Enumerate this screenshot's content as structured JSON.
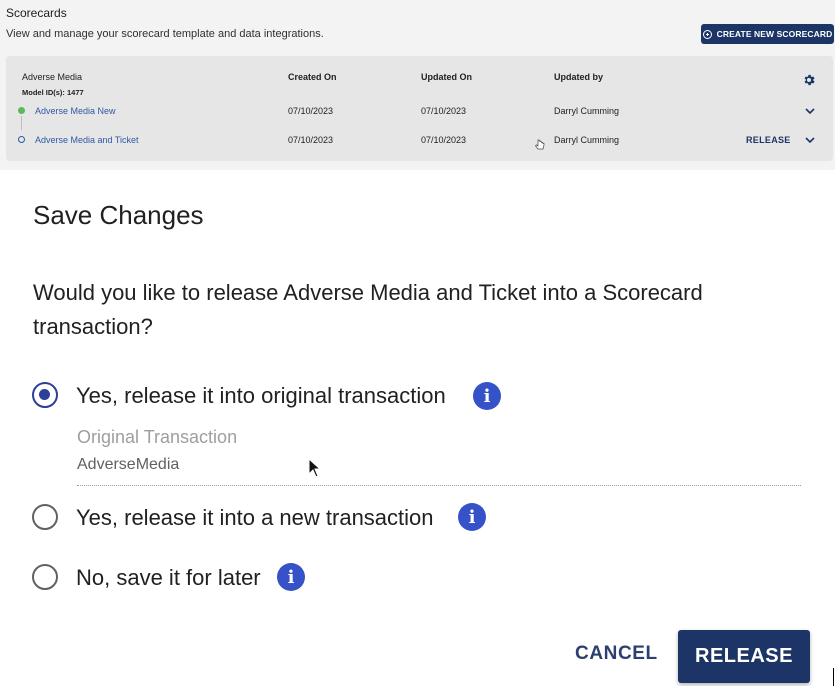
{
  "header": {
    "title": "Scorecards",
    "subtitle": "View and manage your scorecard template and data integrations.",
    "create_button": "CREATE NEW SCORECARD"
  },
  "scorecard": {
    "name": "Adverse Media",
    "model_ids": "Model ID(s): 1477",
    "columns": [
      "Created On",
      "Updated On",
      "Updated by"
    ],
    "rows": [
      {
        "name": "Adverse Media New",
        "created": "07/10/2023",
        "updated": "07/10/2023",
        "updated_by": "Darryl Cumming",
        "status": "active"
      },
      {
        "name": "Adverse Media and Ticket",
        "created": "07/10/2023",
        "updated": "07/10/2023",
        "updated_by": "Darryl Cumming",
        "status": "draft",
        "action": "RELEASE"
      }
    ]
  },
  "dialog": {
    "title": "Save Changes",
    "question": "Would you like to release Adverse Media and Ticket into a Scorecard transaction?",
    "options": [
      {
        "label": "Yes, release it into original transaction",
        "selected": true
      },
      {
        "label": "Yes, release it into a new transaction",
        "selected": false
      },
      {
        "label": "No, save it for later",
        "selected": false
      }
    ],
    "field_label": "Original Transaction",
    "field_value": "AdverseMedia",
    "cancel": "CANCEL",
    "release": "RELEASE"
  },
  "icons": {
    "info": "info-icon",
    "gear": "gear-icon",
    "chevron": "chevron-down-icon",
    "create": "add-circle-icon"
  },
  "colors": {
    "primary": "#1c3566",
    "radio_selected": "#2d3f96",
    "info": "#3552c8",
    "link": "#2d5aa6",
    "active_dot": "#5cb85c"
  }
}
